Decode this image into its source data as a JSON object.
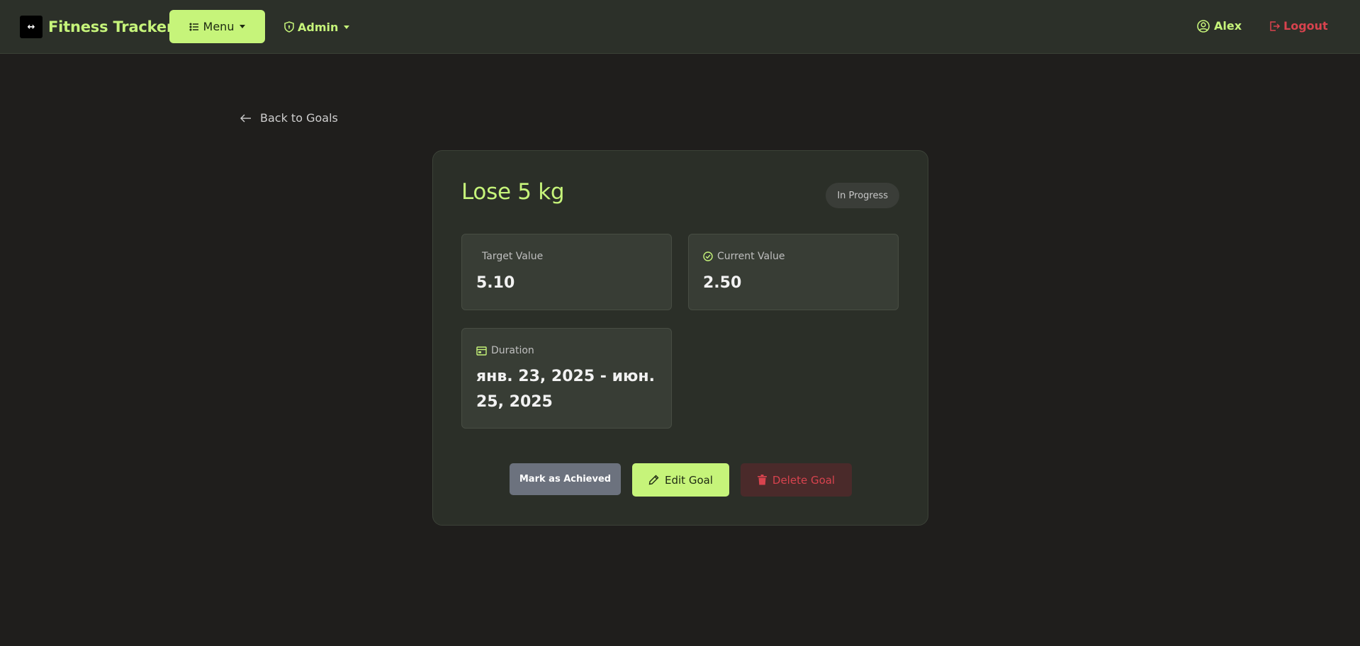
{
  "navbar": {
    "brand_icon": "↔",
    "brand_name": "Fitness Tracker",
    "menu_label": "Menu",
    "admin_label": "Admin",
    "user_name": "Alex",
    "logout_label": "Logout"
  },
  "back_link": {
    "label": "Back to Goals"
  },
  "goal": {
    "title": "Lose 5 kg",
    "status": "In Progress",
    "target": {
      "label": "Target Value",
      "value": "5.10"
    },
    "current": {
      "label": "Current Value",
      "value": "2.50"
    },
    "duration": {
      "label": "Duration",
      "value": "янв. 23, 2025 - июн. 25, 2025"
    }
  },
  "actions": {
    "achieve_label": "Mark as Achieved",
    "edit_label": "Edit Goal",
    "delete_label": "Delete Goal"
  },
  "colors": {
    "accent": "#c6f47a",
    "danger": "#d8434e",
    "background": "#1f1e1c",
    "card": "#2b2f28"
  }
}
